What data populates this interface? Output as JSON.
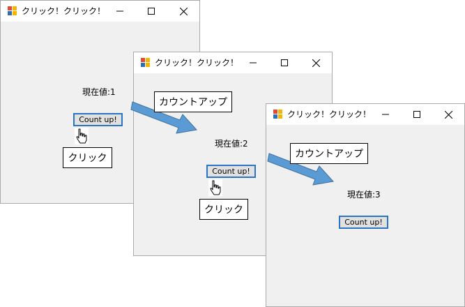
{
  "app_title": "クリック！クリック！",
  "windows": [
    {
      "value_label": "現在値:1",
      "button_label": "Count up!"
    },
    {
      "value_label": "現在値:2",
      "button_label": "Count up!"
    },
    {
      "value_label": "現在値:3",
      "button_label": "Count up!"
    }
  ],
  "annotations": {
    "click_label": "クリック",
    "count_up_label": "カウントアップ"
  },
  "colors": {
    "accent": "#2a74c4",
    "arrow_fill": "#5b9bd5",
    "arrow_stroke": "#41719c"
  }
}
